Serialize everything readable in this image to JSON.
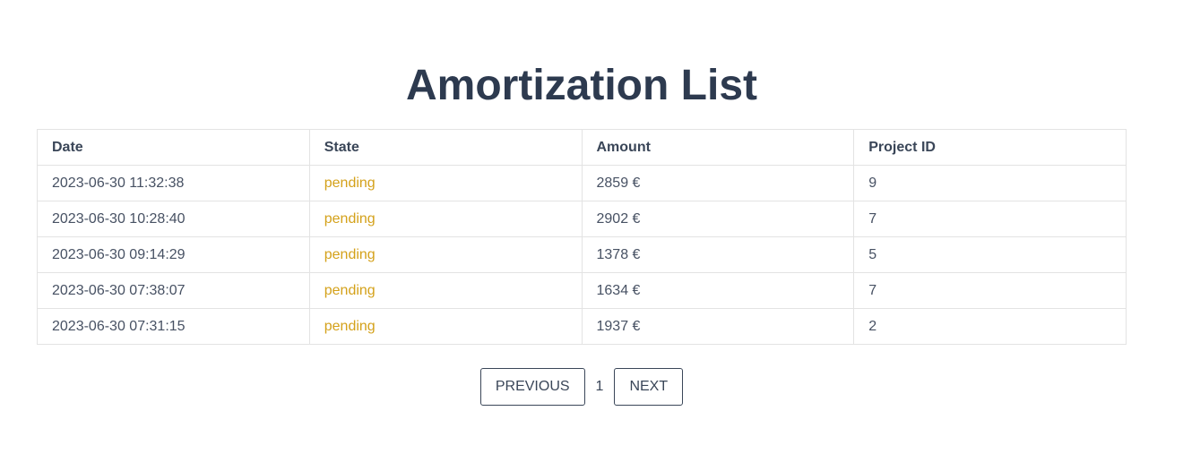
{
  "page": {
    "title": "Amortization List"
  },
  "table": {
    "headers": [
      "Date",
      "State",
      "Amount",
      "Project ID"
    ],
    "rows": [
      {
        "date": "2023-06-30 11:32:38",
        "state": "pending",
        "amount": "2859 €",
        "project_id": "9"
      },
      {
        "date": "2023-06-30 10:28:40",
        "state": "pending",
        "amount": "2902 €",
        "project_id": "7"
      },
      {
        "date": "2023-06-30 09:14:29",
        "state": "pending",
        "amount": "1378 €",
        "project_id": "5"
      },
      {
        "date": "2023-06-30 07:38:07",
        "state": "pending",
        "amount": "1634 €",
        "project_id": "7"
      },
      {
        "date": "2023-06-30 07:31:15",
        "state": "pending",
        "amount": "1937 €",
        "project_id": "2"
      }
    ]
  },
  "pagination": {
    "previous_label": "PREVIOUS",
    "current_page": "1",
    "next_label": "NEXT"
  },
  "colors": {
    "title": "#2d3a4f",
    "state_pending": "#d4a11a",
    "border": "#e3e3e3"
  }
}
